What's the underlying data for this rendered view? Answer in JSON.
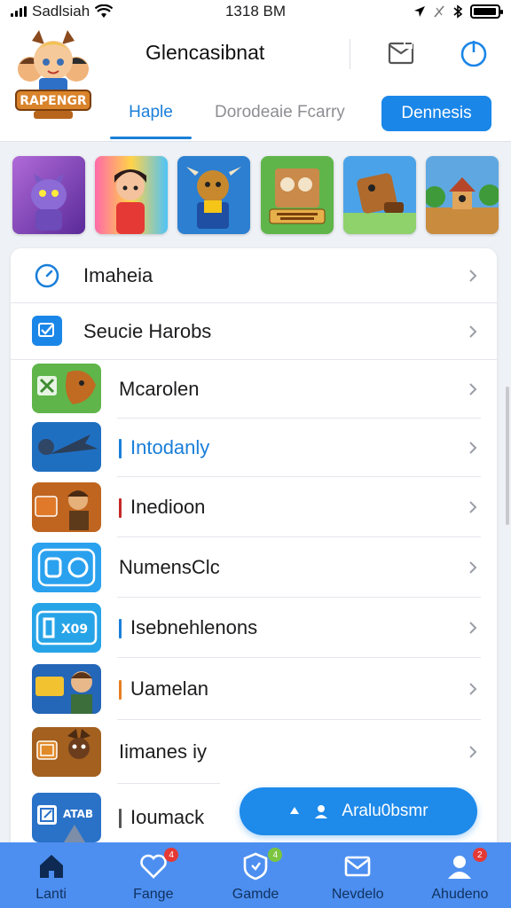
{
  "status_bar": {
    "carrier": "Sadlsiah",
    "time": "1318 BM",
    "battery_level": 0.95
  },
  "header": {
    "logo_text": "RAPENGR",
    "title": "Glencasibnat",
    "tabs": [
      {
        "label": "Haple",
        "active": true
      },
      {
        "label": "Dorodeaie Fcarry",
        "active": false
      }
    ],
    "demo_button": "Dennesis",
    "accent_color": "#1a86e8"
  },
  "thumbnails": [
    {
      "icon": "purple-creature-icon"
    },
    {
      "icon": "girl-character-icon"
    },
    {
      "icon": "bull-character-icon"
    },
    {
      "icon": "board-game-icon"
    },
    {
      "icon": "robot-character-icon"
    },
    {
      "icon": "village-scene-icon"
    }
  ],
  "list": [
    {
      "label": "Imaheia",
      "icon": "clock-icon"
    },
    {
      "label": "Seucie Harobs",
      "icon": "checkbox-icon"
    },
    {
      "label": "Mcarolen",
      "icon": "game-dragon-icon",
      "bar_color": "#2e7d32"
    },
    {
      "label": "Intodanly",
      "icon": "game-jet-icon",
      "bar_color": "#1a7fd9"
    },
    {
      "label": "Inedioon",
      "icon": "game-warrior-icon",
      "bar_color": "#c62828"
    },
    {
      "label": "NumensClc",
      "icon": "game-target-icon"
    },
    {
      "label": "Isebnehlenons",
      "icon": "game-badge-icon",
      "bar_color": "#1a7fd9"
    },
    {
      "label": "Uamelan",
      "icon": "game-hero-icon",
      "bar_color": "#e67e22"
    },
    {
      "label": "Iimanes iy",
      "icon": "game-knight-icon"
    },
    {
      "label": "Ioumack",
      "icon": "game-mage-icon"
    }
  ],
  "fab": {
    "label": "Aralu0bsmr"
  },
  "nav": [
    {
      "label": "Lanti",
      "icon": "home-icon",
      "badge": ""
    },
    {
      "label": "Fange",
      "icon": "heart-icon",
      "badge": "4"
    },
    {
      "label": "Gamde",
      "icon": "shield-icon",
      "badge": "4"
    },
    {
      "label": "Nevdelo",
      "icon": "mail-icon",
      "badge": ""
    },
    {
      "label": "Ahudeno",
      "icon": "person-icon",
      "badge": "2"
    }
  ]
}
